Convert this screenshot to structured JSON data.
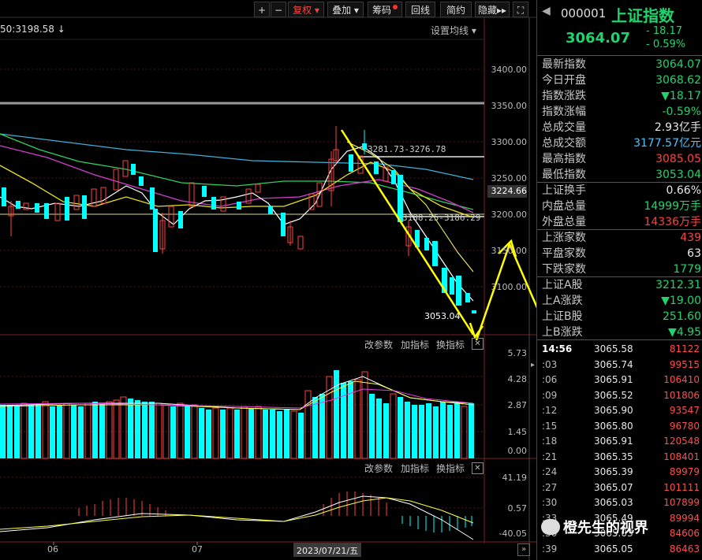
{
  "toolbar": {
    "plus": "+",
    "minus": "−",
    "fuquan": "复权",
    "diejia": "叠加",
    "chouma": "筹码",
    "huixian": "回线",
    "jianyue": "简约",
    "yincang": "隐藏",
    "fullscreen_icon": "expand-icon"
  },
  "main_chart": {
    "ma_readout": "50:3198.58 ↓",
    "settings_label": "设置均线",
    "high_annotation": "3281.73-3276.78",
    "mid_annotation": "3188.25-3186.29",
    "low_annotation": "3053.04",
    "current_price_tag": "3224.66",
    "y_ticks": [
      "3400.00",
      "3350.00",
      "3300.00",
      "3250.00",
      "3200.00",
      "3150.00",
      "3100.00"
    ]
  },
  "volume_panel": {
    "labels": [
      "改参数",
      "加指标",
      "换指标"
    ],
    "y_ticks": [
      "5.73",
      "4.28",
      "2.87",
      "1.45",
      "0.00"
    ]
  },
  "macd_panel": {
    "labels": [
      "改参数",
      "加指标",
      "换指标"
    ],
    "y_ticks": [
      "41.19",
      "0.57",
      "-40.05"
    ]
  },
  "x_axis": {
    "months": [
      "06",
      "07"
    ],
    "cursor_date": "2023/07/21/五"
  },
  "right_panel": {
    "code": "000001",
    "name": "上证指数",
    "price": "3064.07",
    "change": "- 18.17",
    "change_pct": "- 0.59%",
    "stats": [
      {
        "label": "最新指数",
        "value": "3064.07",
        "color": "#22d36b"
      },
      {
        "label": "今日开盘",
        "value": "3068.62",
        "color": "#22d36b"
      },
      {
        "label": "指数涨跌",
        "value": "▼18.17",
        "color": "#22d36b"
      },
      {
        "label": "指数涨幅",
        "value": "-0.59%",
        "color": "#22d36b"
      },
      {
        "label": "总成交量",
        "value": "2.93亿手",
        "color": "#e8e8e8"
      },
      {
        "label": "总成交额",
        "value": "3177.57亿元",
        "color": "#4fc3ff"
      },
      {
        "label": "最高指数",
        "value": "3085.05",
        "color": "#ff4040"
      },
      {
        "label": "最低指数",
        "value": "3053.04",
        "color": "#22d36b"
      },
      {
        "label": "上证换手",
        "value": "0.66%",
        "color": "#e8e8e8"
      },
      {
        "label": "内盘总量",
        "value": "14999万手",
        "color": "#22d36b"
      },
      {
        "label": "外盘总量",
        "value": "14336万手",
        "color": "#ff4040"
      },
      {
        "label": "上涨家数",
        "value": "439",
        "color": "#ff4040"
      },
      {
        "label": "平盘家数",
        "value": "63",
        "color": "#e8e8e8"
      },
      {
        "label": "下跌家数",
        "value": "1779",
        "color": "#22d36b"
      },
      {
        "label": "上证A股",
        "value": "3212.31",
        "color": "#22d36b"
      },
      {
        "label": "上A涨跌",
        "value": "▼19.00",
        "color": "#22d36b"
      },
      {
        "label": "上证B股",
        "value": "251.60",
        "color": "#22d36b"
      },
      {
        "label": "上B涨跌",
        "value": "▼4.95",
        "color": "#22d36b"
      }
    ],
    "ticks": [
      {
        "time": "14:56",
        "price": "3065.58",
        "vol": "81122"
      },
      {
        "time": ":03",
        "price": "3065.74",
        "vol": "99515"
      },
      {
        "time": ":06",
        "price": "3065.91",
        "vol": "106410"
      },
      {
        "time": ":09",
        "price": "3065.52",
        "vol": "101806"
      },
      {
        "time": ":12",
        "price": "3065.90",
        "vol": "93547"
      },
      {
        "time": ":15",
        "price": "3065.80",
        "vol": "96780"
      },
      {
        "time": ":18",
        "price": "3065.91",
        "vol": "120548"
      },
      {
        "time": ":21",
        "price": "3065.35",
        "vol": "108401"
      },
      {
        "time": ":24",
        "price": "3065.39",
        "vol": "89979"
      },
      {
        "time": ":27",
        "price": "3065.07",
        "vol": "101111"
      },
      {
        "time": ":30",
        "price": "3065.03",
        "vol": "107899"
      },
      {
        "time": ":33",
        "price": "3065.49",
        "vol": "89994"
      },
      {
        "time": ":36",
        "price": "3065.03",
        "vol": "84606"
      },
      {
        "time": ":39",
        "price": "3065.05",
        "vol": "86463"
      }
    ]
  },
  "watermark": "橙先生的视界",
  "colors": {
    "up": "#ff4040",
    "down": "#00ffff",
    "arrow": "#ffff00",
    "green": "#22d36b"
  }
}
